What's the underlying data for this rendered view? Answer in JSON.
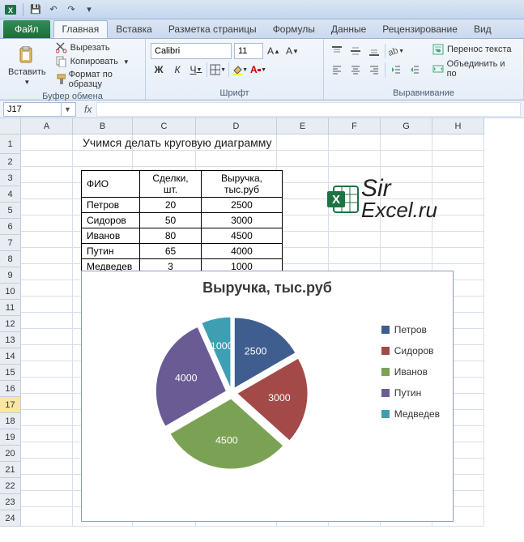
{
  "qat": {
    "save": "💾",
    "undo": "↶",
    "redo": "↷"
  },
  "tabs": {
    "file": "Файл",
    "items": [
      "Главная",
      "Вставка",
      "Разметка страницы",
      "Формулы",
      "Данные",
      "Рецензирование",
      "Вид"
    ],
    "active": 0
  },
  "ribbon": {
    "paste": {
      "label": "Вставить"
    },
    "clipboard": {
      "cut": "Вырезать",
      "copy": "Копировать",
      "format_painter": "Формат по образцу",
      "title": "Буфер обмена"
    },
    "font": {
      "name": "Calibri",
      "size": "11",
      "title": "Шрифт"
    },
    "align": {
      "wrap": "Перенос текста",
      "merge": "Объединить и по",
      "title": "Выравнивание"
    }
  },
  "formula_bar": {
    "name_box": "J17",
    "fx": "fx",
    "formula": ""
  },
  "columns": [
    "A",
    "B",
    "C",
    "D",
    "E",
    "F",
    "G",
    "H"
  ],
  "rows": [
    1,
    2,
    3,
    4,
    5,
    6,
    7,
    8,
    9,
    10,
    11,
    12,
    13,
    14,
    15,
    16,
    17,
    18,
    19,
    20,
    21,
    22,
    23,
    24
  ],
  "selected_row": 17,
  "sheet": {
    "title_cell": "Учимся делать круговую диаграмму",
    "header": {
      "name": "ФИО",
      "deals": "Сделки, шт.",
      "revenue": "Выручка, тыс.руб"
    },
    "rows": [
      {
        "name": "Петров",
        "deals": 20,
        "revenue": 2500
      },
      {
        "name": "Сидоров",
        "deals": 50,
        "revenue": 3000
      },
      {
        "name": "Иванов",
        "deals": 80,
        "revenue": 4500
      },
      {
        "name": "Путин",
        "deals": 65,
        "revenue": 4000
      },
      {
        "name": "Медведев",
        "deals": 3,
        "revenue": 1000
      }
    ]
  },
  "watermark": {
    "line1": "Sir",
    "line2": "Excel.ru"
  },
  "chart_data": {
    "type": "pie",
    "title": "Выручка, тыс.руб",
    "categories": [
      "Петров",
      "Сидоров",
      "Иванов",
      "Путин",
      "Медведев"
    ],
    "values": [
      2500,
      3000,
      4500,
      4000,
      1000
    ],
    "colors": [
      "#3f5e8f",
      "#a34a49",
      "#7ba254",
      "#6b5b95",
      "#3e9fb3"
    ],
    "data_labels": true,
    "legend_position": "right",
    "exploded": true
  }
}
